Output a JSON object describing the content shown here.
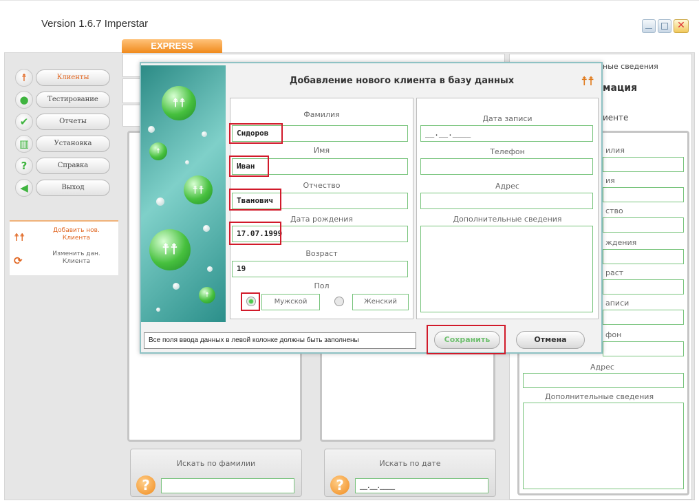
{
  "app": {
    "title": "Version 1.6.7 Imperstar",
    "tab": "EXPRESS"
  },
  "sidebar": {
    "items": [
      {
        "label": "Клиенты",
        "icon": "person-icon"
      },
      {
        "label": "Тестирование",
        "icon": "user-icon"
      },
      {
        "label": "Отчеты",
        "icon": "checkmark-icon"
      },
      {
        "label": "Установка",
        "icon": "chart-icon"
      },
      {
        "label": "Справка",
        "icon": "question-icon"
      },
      {
        "label": "Выход",
        "icon": "exit-arrow-icon"
      }
    ],
    "actions": [
      {
        "label": "Добавить нов. Клиента"
      },
      {
        "label": "Изменить дан. Клиента"
      }
    ]
  },
  "right_panel": {
    "header1": "ные сведения",
    "header2": "мация",
    "header3": "иенте",
    "labels": [
      "илия",
      "ия",
      "ство",
      "ждения",
      "раст",
      "аписи",
      "фон",
      "Адрес",
      "Дополнительные сведения"
    ]
  },
  "search": {
    "by_surname": "Искать по фамилии",
    "by_date": "Искать по дате",
    "date_value": "__.__.____"
  },
  "dialog": {
    "title": "Добавление нового клиента в базу данных",
    "left": {
      "surname_label": "Фамилия",
      "surname_value": "Сидоров",
      "name_label": "Имя",
      "name_value": "Иван",
      "patronymic_label": "Отчество",
      "patronymic_value": "Тванович",
      "birth_label": "Дата рождения",
      "birth_value": "17.07.1999",
      "age_label": "Возраст",
      "age_value": "19",
      "gender_label": "Пол",
      "male": "Мужской",
      "female": "Женский"
    },
    "right": {
      "record_date_label": "Дата записи",
      "record_date_value": "__.__.____",
      "phone_label": "Телефон",
      "address_label": "Адрес",
      "extra_label": "Дополнительные сведения"
    },
    "notice": "Все поля ввода данных в левой колонке должны быть заполнены",
    "save": "Сохранить",
    "cancel": "Отмена"
  },
  "colors": {
    "accent": "#f08a1c",
    "field_border": "#76c37a",
    "highlight": "#d11a2a"
  }
}
